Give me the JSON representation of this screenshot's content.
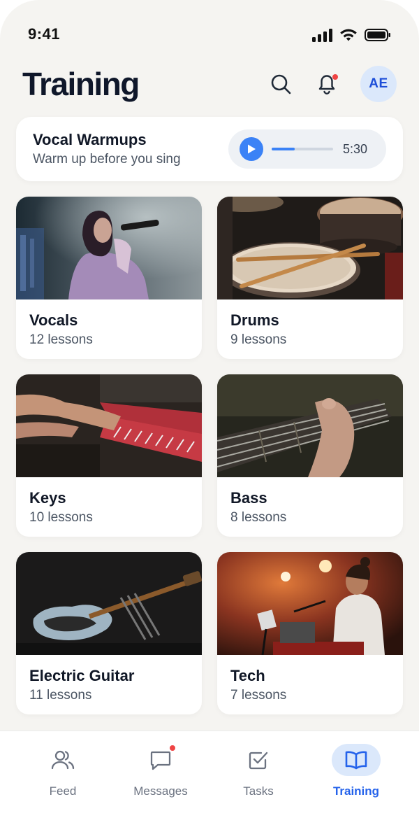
{
  "status_bar": {
    "time": "9:41"
  },
  "header": {
    "title": "Training",
    "avatar_initials": "AE"
  },
  "warmup": {
    "title": "Vocal Warmups",
    "subtitle": "Warm up before you sing",
    "duration": "5:30",
    "progress": 0.38
  },
  "courses": [
    {
      "name": "Vocals",
      "lessons": "12 lessons"
    },
    {
      "name": "Drums",
      "lessons": "9 lessons"
    },
    {
      "name": "Keys",
      "lessons": "10 lessons"
    },
    {
      "name": "Bass",
      "lessons": "8 lessons"
    },
    {
      "name": "Electric Guitar",
      "lessons": "11 lessons"
    },
    {
      "name": "Tech",
      "lessons": "7 lessons"
    }
  ],
  "tabs": [
    {
      "label": "Feed",
      "icon": "users-icon"
    },
    {
      "label": "Messages",
      "icon": "message-icon"
    },
    {
      "label": "Tasks",
      "icon": "checkbox-icon"
    },
    {
      "label": "Training",
      "icon": "book-icon"
    }
  ],
  "colors": {
    "accent": "#3b82f6",
    "accent_dark": "#2563eb",
    "badge": "#ef4444",
    "active_bg": "#dbe8fb"
  }
}
